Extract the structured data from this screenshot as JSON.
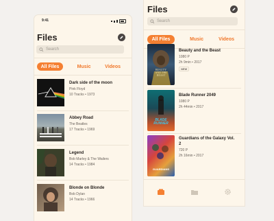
{
  "left": {
    "status_time": "9:41",
    "title": "Files",
    "search_placeholder": "Search",
    "tabs": [
      "All Files",
      "Music",
      "Videos"
    ],
    "items": [
      {
        "title": "Dark side of the moon",
        "artist": "Pink Floyd",
        "meta": "10 Tracks  •  1973",
        "art_icon": "prism-album-art"
      },
      {
        "title": "Abbey Road",
        "artist": "The Beatles",
        "meta": "17 Tracks  •  1969",
        "art_icon": "crosswalk-album-art"
      },
      {
        "title": "Legend",
        "artist": "Bob Marley & The Wailers",
        "meta": "14 Tracks  •  1984",
        "art_icon": "portrait-album-art"
      },
      {
        "title": "Blonde on Blonde",
        "artist": "Bob Dylan",
        "meta": "14 Tracks  •  1966",
        "art_icon": "blurred-portrait-album-art"
      }
    ]
  },
  "right": {
    "title": "Files",
    "search_placeholder": "Search",
    "tabs": [
      "All Files",
      "Music",
      "Videos"
    ],
    "items": [
      {
        "title": "Beauty and the Beast",
        "quality": "1080 P",
        "meta": "2h 9min  •  2017",
        "badge": "NEW",
        "poster_text": "BEAUTY\nAND THE\nBEAST"
      },
      {
        "title": "Blade Runner 2049",
        "quality": "1080 P",
        "meta": "2h 44min  •  2017",
        "poster_text": "BLADE\nRUNNER"
      },
      {
        "title": "Guardians of the Galaxy Vol. 2",
        "quality": "720 P",
        "meta": "2h 16min  •  2017",
        "poster_text": "GUARDIANS"
      }
    ],
    "nav": [
      "files-tab-icon",
      "folder-icon",
      "gear-icon"
    ]
  },
  "colors": {
    "accent": "#f58032",
    "background": "#fdf6ea",
    "text": "#2a2522"
  }
}
